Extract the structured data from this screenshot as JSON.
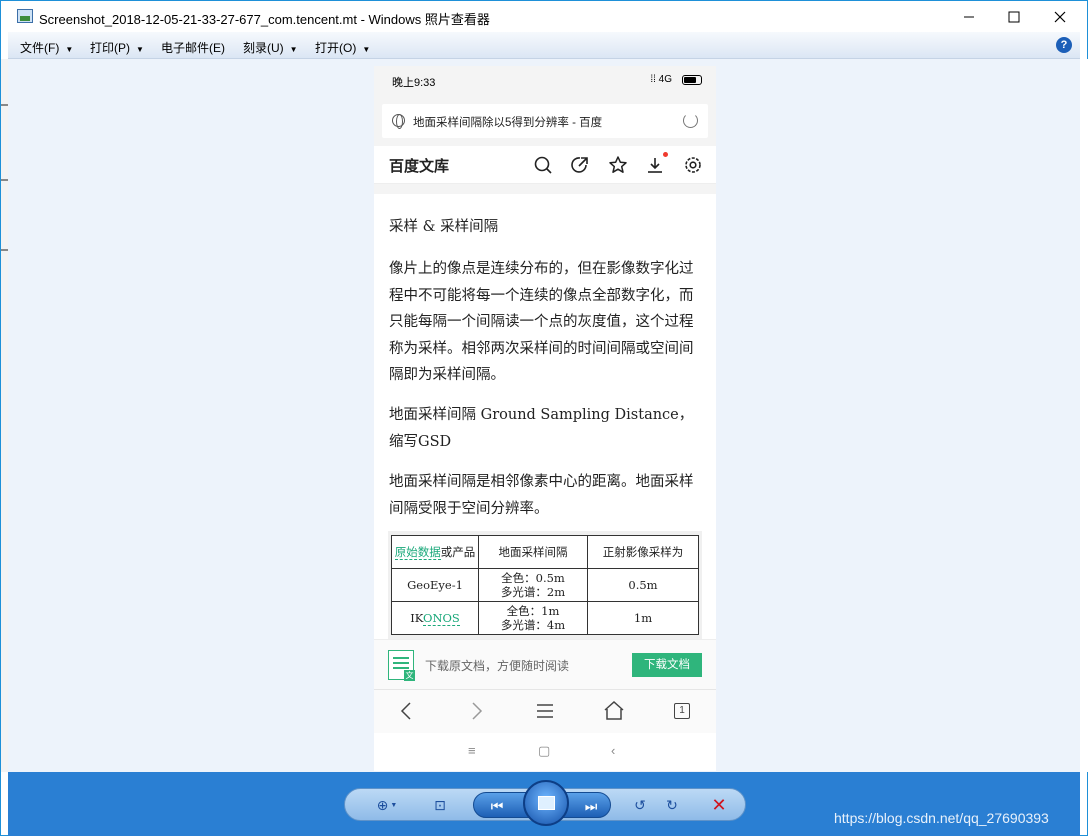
{
  "window": {
    "title": "Screenshot_2018-12-05-21-33-27-677_com.tencent.mt - Windows 照片查看器",
    "min_icon": "minimize-icon",
    "max_icon": "maximize-icon",
    "close_icon": "close-icon"
  },
  "menubar": {
    "items": [
      {
        "label": "文件(F)"
      },
      {
        "label": "打印(P)"
      },
      {
        "label": "电子邮件(E)"
      },
      {
        "label": "刻录(U)"
      },
      {
        "label": "打开(O)"
      }
    ],
    "help": "?"
  },
  "phone": {
    "status": {
      "time": "晚上9:33",
      "network": "4G"
    },
    "url": "地面采样间隔除以5得到分辨率 - 百度",
    "site_name": "百度文库",
    "paragraphs": [
      "采样 & 采样间隔",
      "像片上的像点是连续分布的，但在影像数字化过程中不可能将每一个连续的像点全部数字化，而只能每隔一个间隔读一个点的灰度值，这个过程称为采样。相邻两次采样间的时间间隔或空间间隔即为采样间隔。",
      "地面采样间隔 Ground Sampling Distance，缩写GSD",
      "地面采样间隔是相邻像素中心的距离。地面采样间隔受限于空间分辨率。"
    ],
    "table": {
      "header": {
        "c1_link": "原始数据",
        "c1_rest": "或产品",
        "c2": "地面采样间隔",
        "c3": "正射影像采样为"
      },
      "rows": [
        {
          "name_pre": "GeoEye-1",
          "name_link": "",
          "gsd1": "全色：0.5m",
          "gsd2": "多光谱：2m",
          "ortho": "0.5m"
        },
        {
          "name_pre": "IK",
          "name_link": "ONOS",
          "gsd1": "全色：1m",
          "gsd2": "多光谱：4m",
          "ortho": "1m"
        }
      ]
    },
    "download": {
      "text": "下载原文档，方便随时阅读",
      "button": "下载文档",
      "badge": "文"
    },
    "tab_count": "1"
  },
  "watermark": "https://blog.csdn.net/qq_27690393",
  "colors": {
    "accent_green": "#2fb57c",
    "bottom_bar": "#2a7fd3",
    "link_green": "#1aa87a"
  }
}
